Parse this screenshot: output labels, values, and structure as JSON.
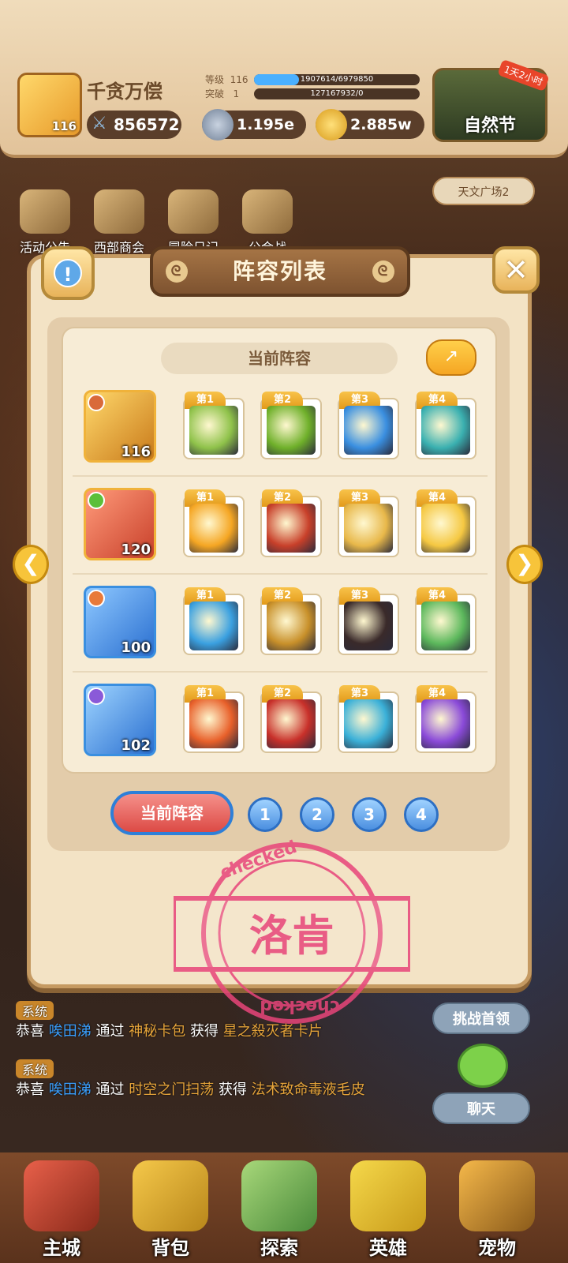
{
  "player": {
    "name": "千贪万偿",
    "level": "116",
    "power": "856572",
    "stats": [
      {
        "label": "等级",
        "value": "116",
        "bar": "1907614/6979850",
        "progress": 0.27
      },
      {
        "label": "突破",
        "value": "1",
        "bar": "127167932/0",
        "progress": 0.0
      }
    ]
  },
  "currencies": {
    "gems": "1.195e",
    "gold": "2.885w"
  },
  "festival": {
    "label": "自然节",
    "tag": "1天2小时"
  },
  "top_menu": [
    "活动公告",
    "西部商会",
    "冒险日记",
    "公会战"
  ],
  "plaza": "天文广场2",
  "modal": {
    "title": "阵容列表",
    "section_title": "当前阵容",
    "lineups": [
      {
        "hero_level": "116",
        "skills": [
          "第1",
          "第2",
          "第3",
          "第4"
        ],
        "color": "#f0b23a"
      },
      {
        "hero_level": "120",
        "skills": [
          "第1",
          "第2",
          "第3",
          "第4"
        ],
        "color": "#f0b23a"
      },
      {
        "hero_level": "100",
        "skills": [
          "第1",
          "第2",
          "第3",
          "第4"
        ],
        "color": "#3a8fe0"
      },
      {
        "hero_level": "102",
        "skills": [
          "第1",
          "第2",
          "第3",
          "第4"
        ],
        "color": "#3a8fe0"
      }
    ],
    "tabs": {
      "current": "当前阵容",
      "numbers": [
        "1",
        "2",
        "3",
        "4"
      ]
    }
  },
  "stamp": {
    "text": "洛肯",
    "ring": "checked"
  },
  "chat": [
    {
      "tag": "系统",
      "prefix": "恭喜",
      "user": "唉田涕",
      "mid": "通过",
      "source": "神秘卡包",
      "mid2": "获得",
      "reward": "星之殺灭者卡片"
    },
    {
      "tag": "系统",
      "prefix": "恭喜",
      "user": "唉田涕",
      "mid": "通过",
      "source": "时空之门扫荡",
      "mid2": "获得",
      "reward": "法术致命毒液毛皮"
    }
  ],
  "side_buttons": {
    "challenge": "挑战首领",
    "chat": "聊天"
  },
  "bottom_nav": [
    "主城",
    "背包",
    "探索",
    "英雄",
    "宠物"
  ]
}
